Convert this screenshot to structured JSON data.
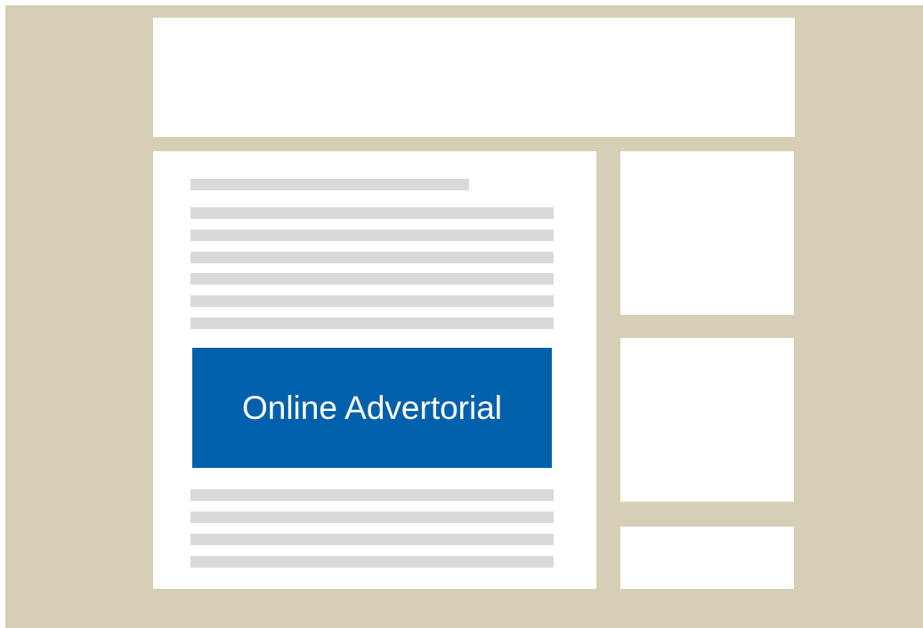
{
  "advertorial": {
    "label": "Online Advertorial",
    "color": "#0060ac"
  },
  "colors": {
    "background": "#d6cfb6",
    "panel": "#ffffff",
    "placeholder_text": "#d9d9d9"
  }
}
